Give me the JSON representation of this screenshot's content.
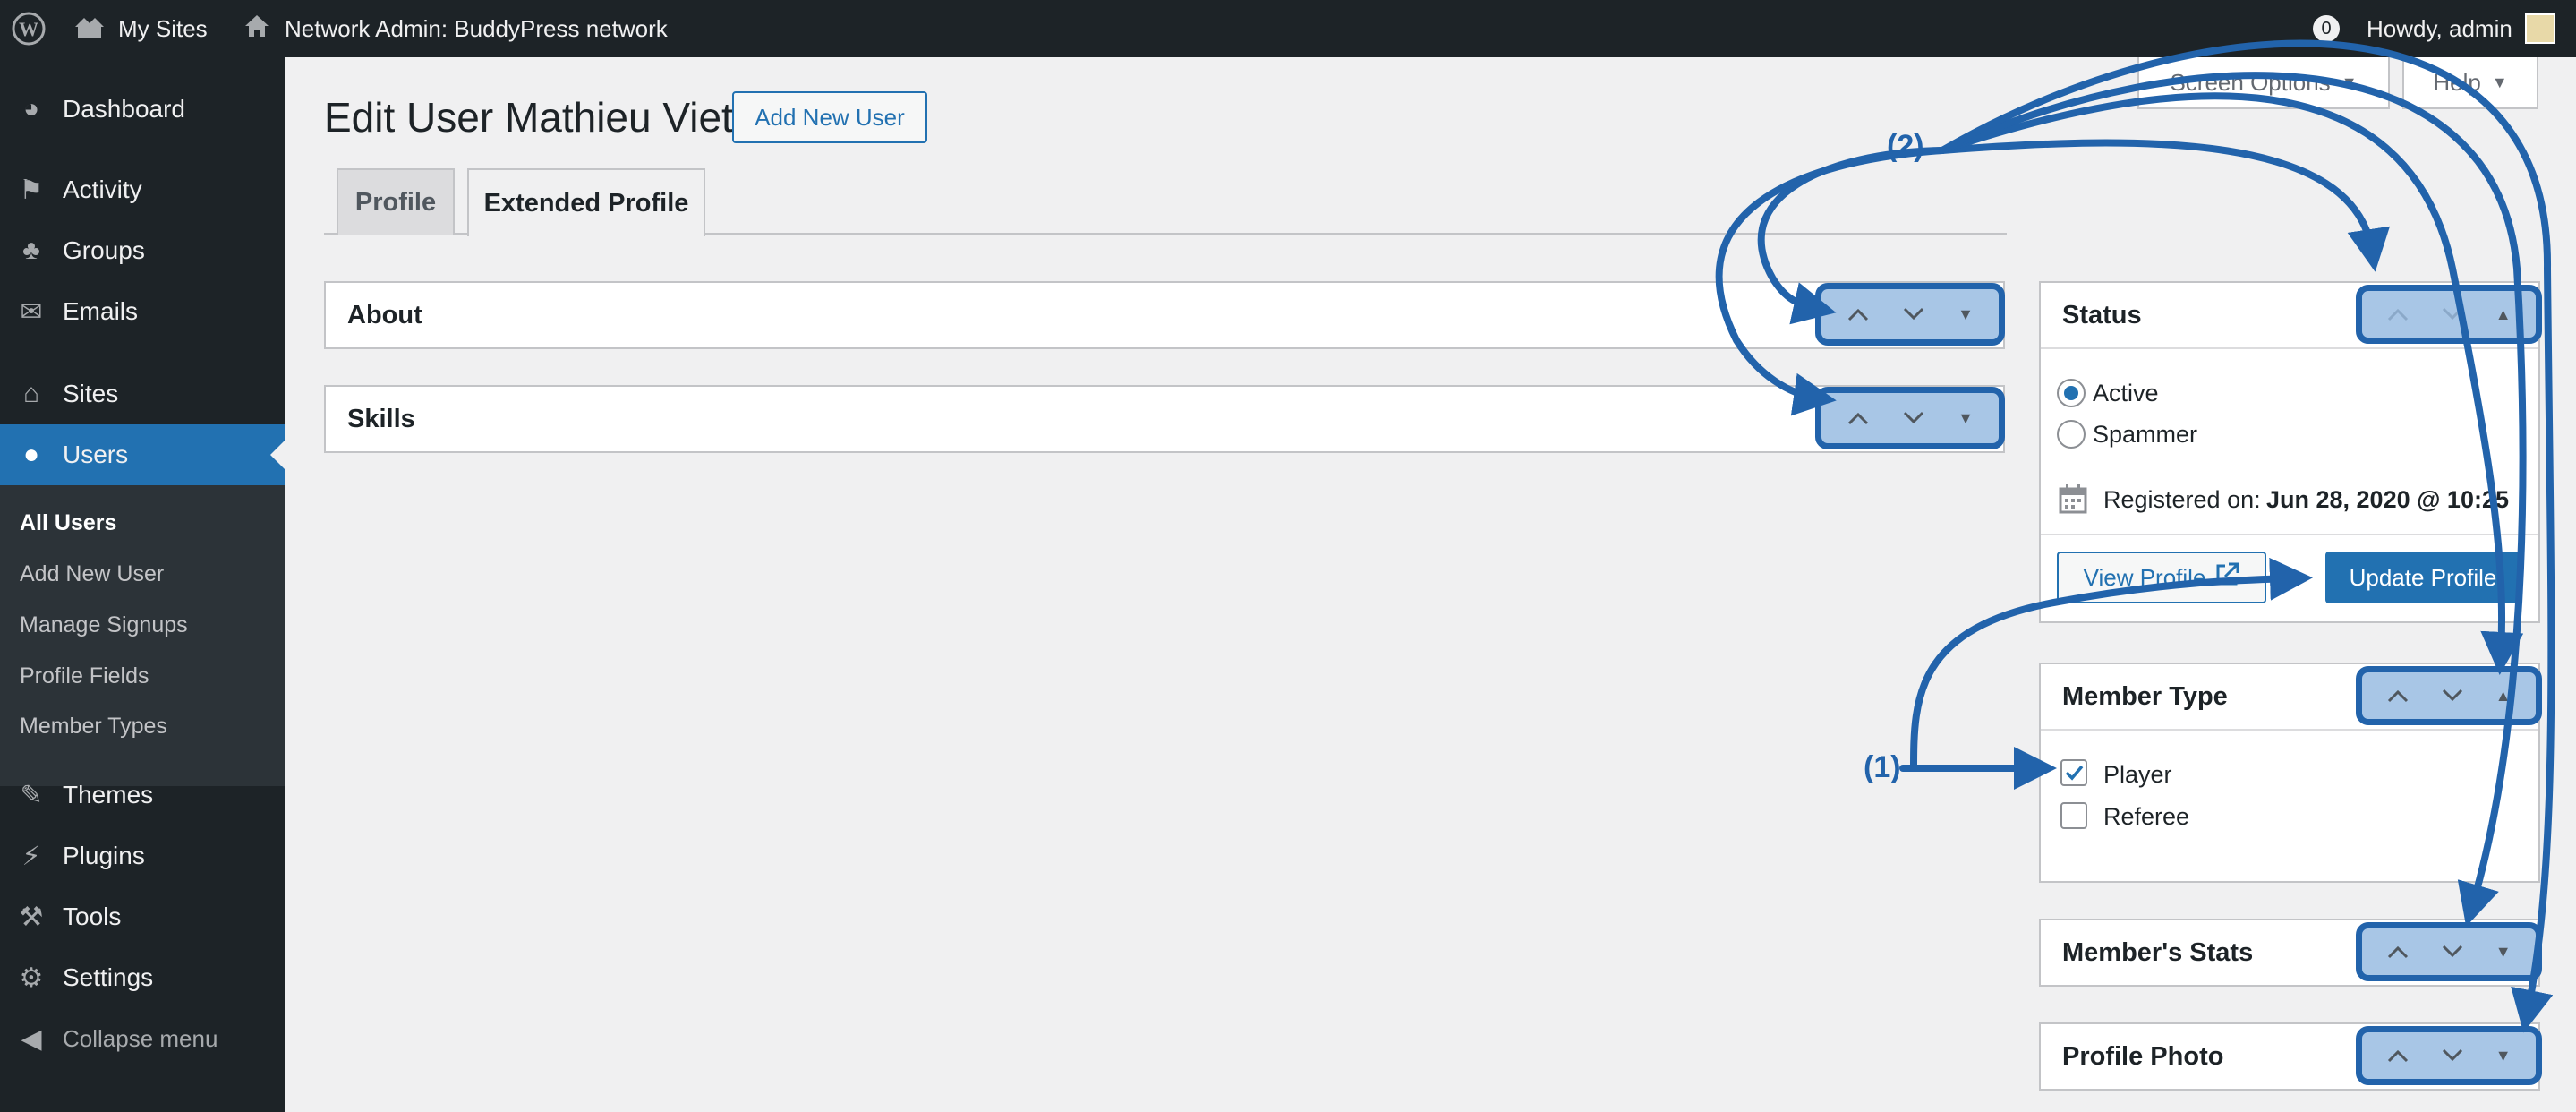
{
  "adminbar": {
    "my_sites": "My Sites",
    "network_admin": "Network Admin: BuddyPress network",
    "notifications_count": "0",
    "howdy": "Howdy, admin"
  },
  "screen_options": {
    "screen_options_label": "Screen Options",
    "help_label": "Help"
  },
  "sidebar": {
    "items": [
      {
        "label": "Dashboard",
        "icon": "dashboard-icon"
      },
      {
        "label": "Activity",
        "icon": "activity-icon"
      },
      {
        "label": "Groups",
        "icon": "groups-icon"
      },
      {
        "label": "Emails",
        "icon": "email-icon"
      },
      {
        "label": "Sites",
        "icon": "sites-icon"
      },
      {
        "label": "Users",
        "icon": "users-icon",
        "current": true
      },
      {
        "label": "Themes",
        "icon": "themes-icon"
      },
      {
        "label": "Plugins",
        "icon": "plugins-icon"
      },
      {
        "label": "Tools",
        "icon": "tools-icon"
      },
      {
        "label": "Settings",
        "icon": "settings-icon"
      },
      {
        "label": "Collapse menu",
        "icon": "collapse-icon"
      }
    ],
    "submenu": [
      {
        "label": "All Users",
        "current": true
      },
      {
        "label": "Add New User"
      },
      {
        "label": "Manage Signups"
      },
      {
        "label": "Profile Fields"
      },
      {
        "label": "Member Types"
      }
    ]
  },
  "main": {
    "title": "Edit User Mathieu Viet",
    "add_new_label": "Add New User",
    "tabs": [
      {
        "label": "Profile"
      },
      {
        "label": "Extended Profile",
        "active": true
      }
    ],
    "boxes": {
      "about": "About",
      "skills": "Skills"
    }
  },
  "side": {
    "status": {
      "title": "Status",
      "options": [
        {
          "label": "Active",
          "checked": true
        },
        {
          "label": "Spammer",
          "checked": false
        }
      ],
      "registered_label": "Registered on:",
      "registered_value": "Jun 28, 2020 @ 10:25",
      "view_profile_label": "View Profile",
      "update_profile_label": "Update Profile"
    },
    "member_type": {
      "title": "Member Type",
      "options": [
        {
          "label": "Player",
          "checked": true
        },
        {
          "label": "Referee",
          "checked": false
        }
      ]
    },
    "member_stats": {
      "title": "Member's Stats"
    },
    "profile_photo": {
      "title": "Profile Photo"
    }
  },
  "annotations": {
    "one": "(1)",
    "two": "(2)"
  },
  "colors": {
    "accent": "#2271b1",
    "annotation": "#2263ab",
    "adminbar": "#1d2327"
  }
}
